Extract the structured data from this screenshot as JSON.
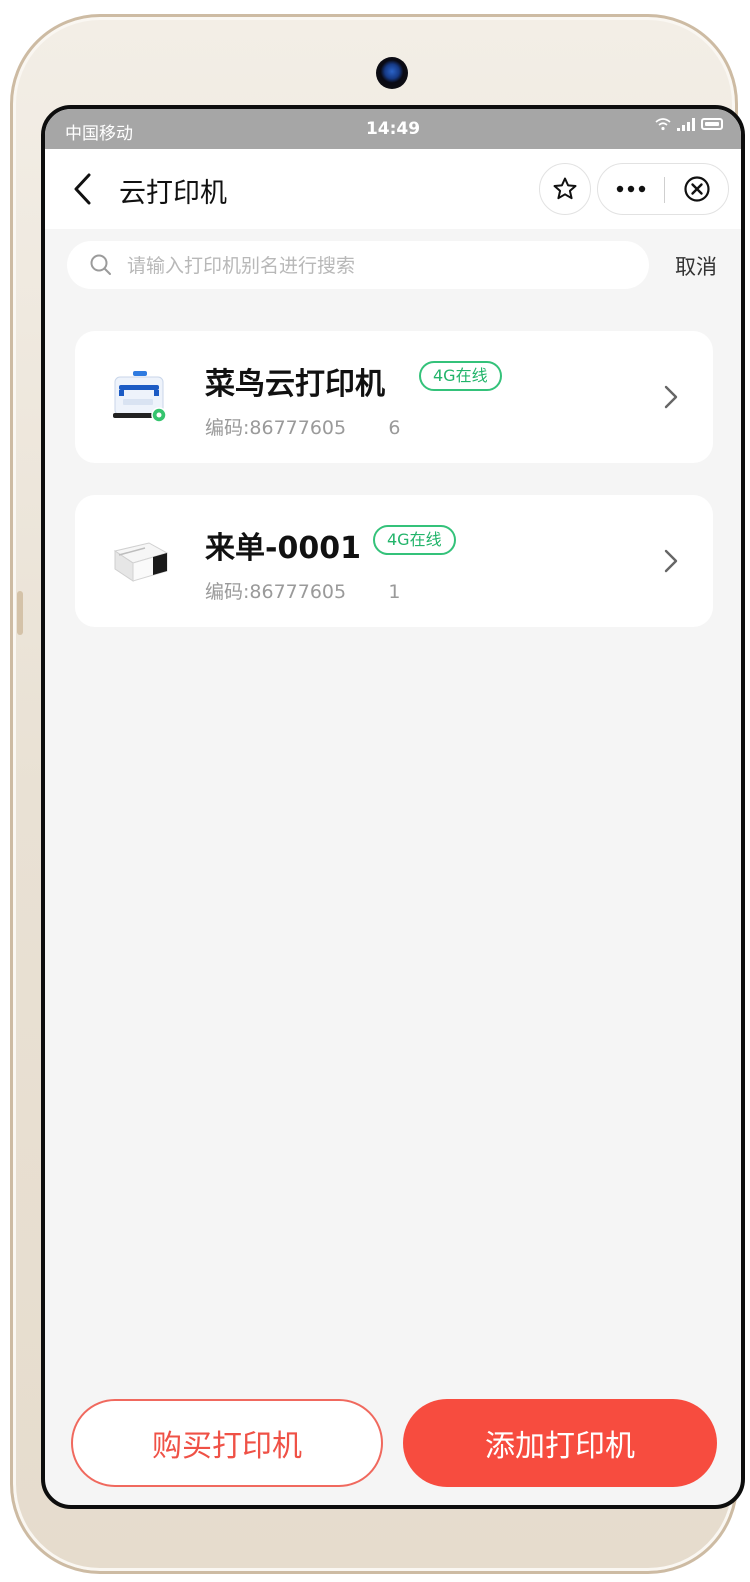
{
  "status_bar": {
    "carrier": "中国移动",
    "time": "14:49"
  },
  "nav": {
    "title": "云打印机"
  },
  "search": {
    "placeholder": "请输入打印机别名进行搜索",
    "value": "",
    "cancel_label": "取消"
  },
  "printers": [
    {
      "name": "菜鸟云打印机",
      "status": "4G在线",
      "code": "编码:86777605       6",
      "icon": "cainiao-printer-icon"
    },
    {
      "name": "来单-0001",
      "status": "4G在线",
      "code": "编码:86777605       1",
      "icon": "label-printer-icon"
    }
  ],
  "actions": {
    "buy_label": "购买打印机",
    "add_label": "添加打印机"
  },
  "colors": {
    "accent": "#f74c3f",
    "online": "#34c27a",
    "background": "#f5f5f5"
  }
}
